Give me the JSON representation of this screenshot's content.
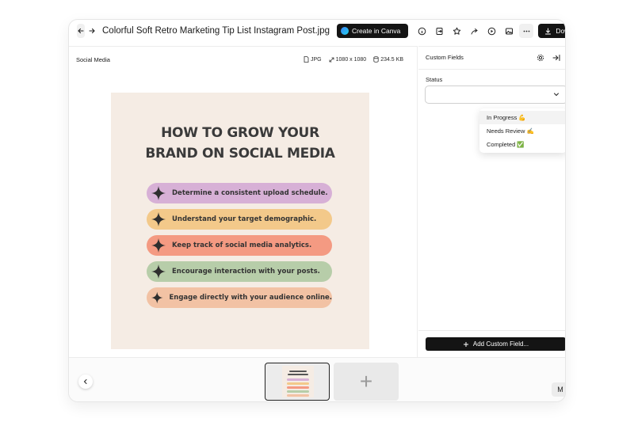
{
  "header": {
    "title": "Colorful Soft Retro Marketing Tip List Instagram Post.jpg",
    "create_in_canva": "Create in Canva",
    "download": "Download",
    "tool_icons": [
      "info-icon",
      "export-icon",
      "star-icon",
      "share-icon",
      "play-icon",
      "image-icon",
      "more-icon"
    ]
  },
  "main": {
    "folder": "Social Media",
    "file_type": "JPG",
    "dimensions": "1080 x 1080",
    "file_size": "234.5 KB"
  },
  "poster": {
    "title_line1": "HOW TO GROW YOUR",
    "title_line2": "BRAND ON SOCIAL MEDIA",
    "tips": [
      {
        "text": "Determine a consistent upload schedule.",
        "color": "#d7b0d6"
      },
      {
        "text": "Understand your target demographic.",
        "color": "#f3c98a"
      },
      {
        "text": "Keep track of social media analytics.",
        "color": "#f49a82"
      },
      {
        "text": "Encourage interaction with your posts.",
        "color": "#b7cda9"
      },
      {
        "text": "Engage directly with your audience online.",
        "color": "#f2c2a4"
      }
    ]
  },
  "side_panel": {
    "title": "Custom Fields",
    "status_label": "Status",
    "status_value": "",
    "status_options": [
      "In Progress 💪",
      "Needs Review ✍️",
      "Completed ✅"
    ],
    "add_field": "Add Custom Field..."
  },
  "filmstrip": {
    "add_symbol": "+",
    "corner_button": "M"
  }
}
